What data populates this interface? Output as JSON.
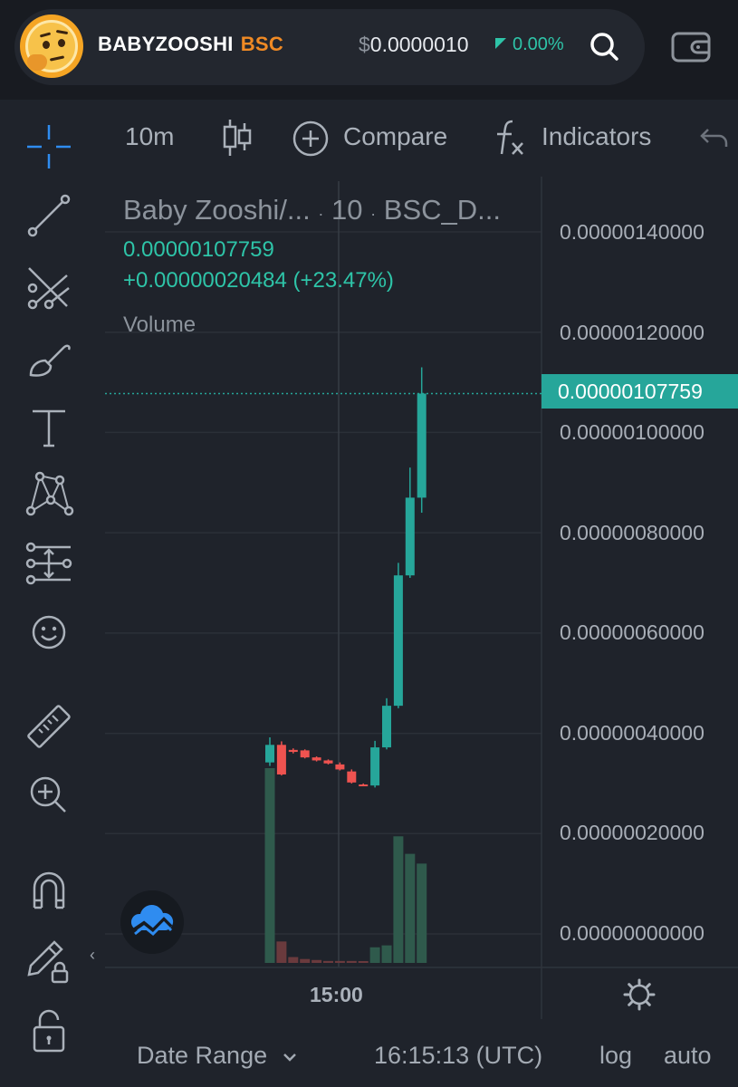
{
  "header": {
    "token_name": "BABYZOOSHI",
    "token_chain": "BSC",
    "price_currency": "$",
    "price": "0.0000010",
    "change": "0.00%",
    "avatar_icon": "thinking-face-icon",
    "search_icon": "search-icon",
    "wallet_icon": "wallet-icon"
  },
  "left_toolbar": {
    "tools": [
      "crosshair-icon",
      "trend-line-icon",
      "pitchfork-icon",
      "brush-icon",
      "text-icon",
      "pattern-icon",
      "fib-tool-icon",
      "emoji-icon",
      "ruler-icon",
      "zoom-in-icon",
      "magnet-icon",
      "lock-drawing-icon",
      "unlock-icon"
    ],
    "collapse_icon": "‹"
  },
  "chart_toolbar": {
    "interval": "10m",
    "chart_type_icon": "candles-icon",
    "compare": "Compare",
    "indicators": "Indicators",
    "undo_icon": "undo-icon"
  },
  "legend": {
    "symbol": "Baby Zooshi/...",
    "sep1": "·",
    "interval": "10",
    "sep2": "·",
    "exchange": "BSC_D...",
    "price": "0.00000107759",
    "change": "+0.00000020484 (+23.47%)",
    "volume_label": "Volume"
  },
  "price_axis": {
    "labels": [
      "0.00000140000",
      "0.00000120000",
      "0.00000100000",
      "0.00000080000",
      "0.00000060000",
      "0.00000040000",
      "0.00000020000",
      "0.00000000000"
    ],
    "last_price": "0.00000107759"
  },
  "time_axis": {
    "labels": [
      "15:00"
    ]
  },
  "bottom_bar": {
    "date_range": "Date Range",
    "time": "16:15:13 (UTC)",
    "log": "log",
    "auto": "auto"
  },
  "colors": {
    "up": "#26a69a",
    "down": "#ef5350",
    "accent": "#2ec4a8",
    "chain": "#f08a24"
  },
  "chart_data": {
    "type": "candlestick",
    "ylim": [
      -6e-08,
      1.51e-06
    ],
    "last_price": 1.07759e-06,
    "candles": [
      {
        "o": 3.42e-07,
        "h": 3.92e-07,
        "l": 3.35e-07,
        "c": 3.77e-07,
        "v": 1.0
      },
      {
        "o": 3.77e-07,
        "h": 3.84e-07,
        "l": 3.16e-07,
        "c": 3.18e-07,
        "v": 0.11
      },
      {
        "o": 3.67e-07,
        "h": 3.7e-07,
        "l": 3.6e-07,
        "c": 3.63e-07,
        "v": 0.03
      },
      {
        "o": 3.66e-07,
        "h": 3.68e-07,
        "l": 3.5e-07,
        "c": 3.52e-07,
        "v": 0.02
      },
      {
        "o": 3.52e-07,
        "h": 3.54e-07,
        "l": 3.44e-07,
        "c": 3.46e-07,
        "v": 0.015
      },
      {
        "o": 3.46e-07,
        "h": 3.48e-07,
        "l": 3.38e-07,
        "c": 3.4e-07,
        "v": 0.01
      },
      {
        "o": 3.38e-07,
        "h": 3.42e-07,
        "l": 3.26e-07,
        "c": 3.28e-07,
        "v": 0.01
      },
      {
        "o": 3.24e-07,
        "h": 3.28e-07,
        "l": 3e-07,
        "c": 3.02e-07,
        "v": 0.01
      },
      {
        "o": 2.98e-07,
        "h": 3e-07,
        "l": 2.95e-07,
        "c": 2.96e-07,
        "v": 0.005
      },
      {
        "o": 2.96e-07,
        "h": 3.85e-07,
        "l": 2.92e-07,
        "c": 3.72e-07,
        "v": 0.08
      },
      {
        "o": 3.72e-07,
        "h": 4.7e-07,
        "l": 3.68e-07,
        "c": 4.55e-07,
        "v": 0.09
      },
      {
        "o": 4.55e-07,
        "h": 7.4e-07,
        "l": 4.5e-07,
        "c": 7.15e-07,
        "v": 0.65
      },
      {
        "o": 7.15e-07,
        "h": 9.3e-07,
        "l": 7.1e-07,
        "c": 8.7e-07,
        "v": 0.56
      },
      {
        "o": 8.7e-07,
        "h": 1.13e-06,
        "l": 8.4e-07,
        "c": 1.07759e-06,
        "v": 0.51
      }
    ]
  }
}
